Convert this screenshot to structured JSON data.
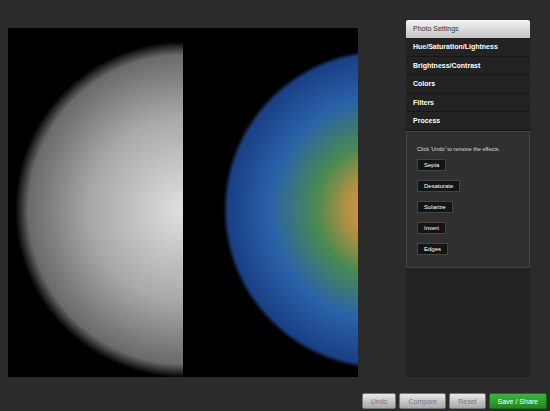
{
  "settings_panel": {
    "header": "Photo Settings",
    "sections": [
      {
        "label": "Hue/Saturation/Lightness",
        "expanded": false
      },
      {
        "label": "Brightness/Contrast",
        "expanded": false
      },
      {
        "label": "Colors",
        "expanded": false
      },
      {
        "label": "Filters",
        "expanded": false
      },
      {
        "label": "Process",
        "expanded": true
      }
    ],
    "process": {
      "hint": "Click 'Undo' to remove the effects.",
      "buttons": [
        "Sepia",
        "Desaturate",
        "Solarize",
        "Invert",
        "Edges"
      ]
    }
  },
  "toolbar": {
    "buttons": [
      {
        "label": "Undo",
        "kind": "secondary"
      },
      {
        "label": "Compare",
        "kind": "secondary"
      },
      {
        "label": "Reset",
        "kind": "secondary"
      },
      {
        "label": "Save / Share",
        "kind": "primary"
      }
    ]
  }
}
